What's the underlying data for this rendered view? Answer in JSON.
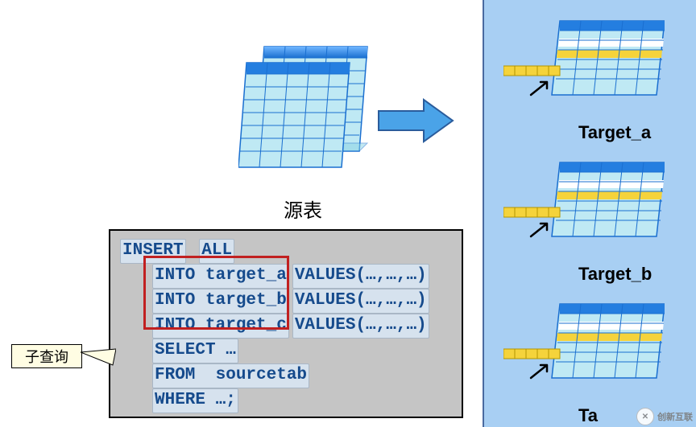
{
  "source_label": "源表",
  "targets": {
    "a": "Target_a",
    "b": "Target_b",
    "c": "Ta"
  },
  "callout": "子查询",
  "code": {
    "l1a": "INSERT",
    "l1b": "ALL",
    "l2a": "INTO target_a",
    "l2b": "VALUES(…,…,…)",
    "l3a": "INTO target_b",
    "l3b": "VALUES(…,…,…)",
    "l4a": "INTO target_c",
    "l4b": "VALUES(…,…,…)",
    "l5": "SELECT …",
    "l6": "FROM  sourcetab",
    "l7": "WHERE …;"
  },
  "watermark": "创新互联",
  "colors": {
    "panel": "#a8cff3",
    "arrow_fill": "#4aa3e8",
    "arrow_stroke": "#2a5c9c",
    "code_bg": "#c5c5c5",
    "code_text": "#154a8c",
    "highlight_border": "#c12020"
  }
}
